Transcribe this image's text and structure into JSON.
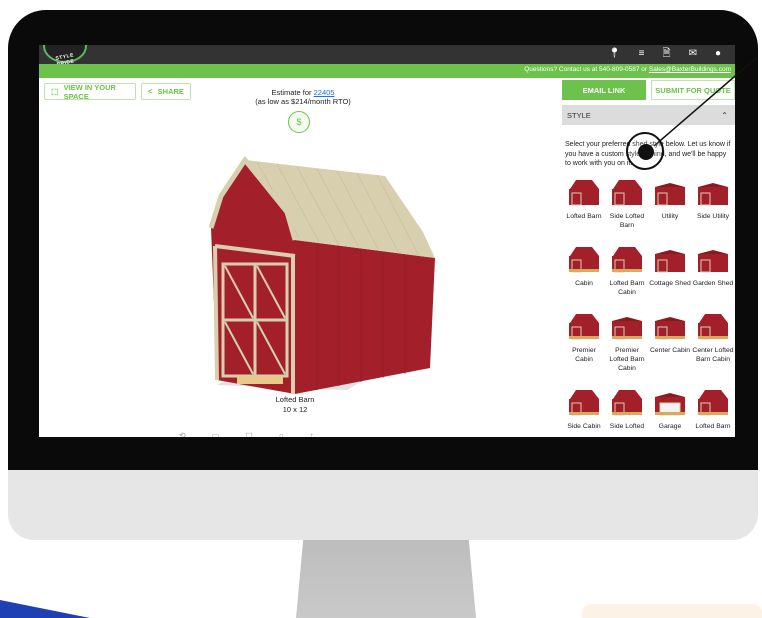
{
  "header": {
    "logo_text": "STYLE PRIDE",
    "nav_icons": [
      "location-pin-icon",
      "list-icon",
      "document-icon",
      "mail-icon",
      "user-icon"
    ]
  },
  "contact_bar": {
    "prefix": "Questions? Contact us at 540-809-0587 or ",
    "email": "Sales@BaxterBuildings.com"
  },
  "viewer": {
    "view_space_label": "VIEW IN YOUR SPACE",
    "share_label": "SHARE",
    "estimate_prefix": "Estimate for ",
    "zip": "22405",
    "monthly": "(as low as $214/month RTO)",
    "model_name": "Lofted Barn",
    "model_size": "10 x 12"
  },
  "panel": {
    "email_link_label": "EMAIL LINK",
    "submit_quote_label": "SUBMIT FOR QUOTE",
    "section_title": "STYLE",
    "section_desc": "Select your preferred shed style below. Let us know if you have a custom style in mind, and we'll be happy to work with you on it.",
    "styles": [
      {
        "label": "Lofted Barn"
      },
      {
        "label": "Side Lofted Barn"
      },
      {
        "label": "Utility"
      },
      {
        "label": "Side Utility"
      },
      {
        "label": "Cabin"
      },
      {
        "label": "Lofted Barn Cabin"
      },
      {
        "label": "Cottage Shed"
      },
      {
        "label": "Garden Shed"
      },
      {
        "label": "Premier Cabin"
      },
      {
        "label": "Premier Lofted Barn Cabin"
      },
      {
        "label": "Center Cabin"
      },
      {
        "label": "Center Lofted Barn Cabin"
      },
      {
        "label": "Side Cabin"
      },
      {
        "label": "Side Lofted"
      },
      {
        "label": "Garage"
      },
      {
        "label": "Lofted Barn"
      }
    ]
  },
  "colors": {
    "brand_green": "#6cc24a",
    "shed_red": "#a3202a",
    "trim_tan": "#d8cfae"
  }
}
